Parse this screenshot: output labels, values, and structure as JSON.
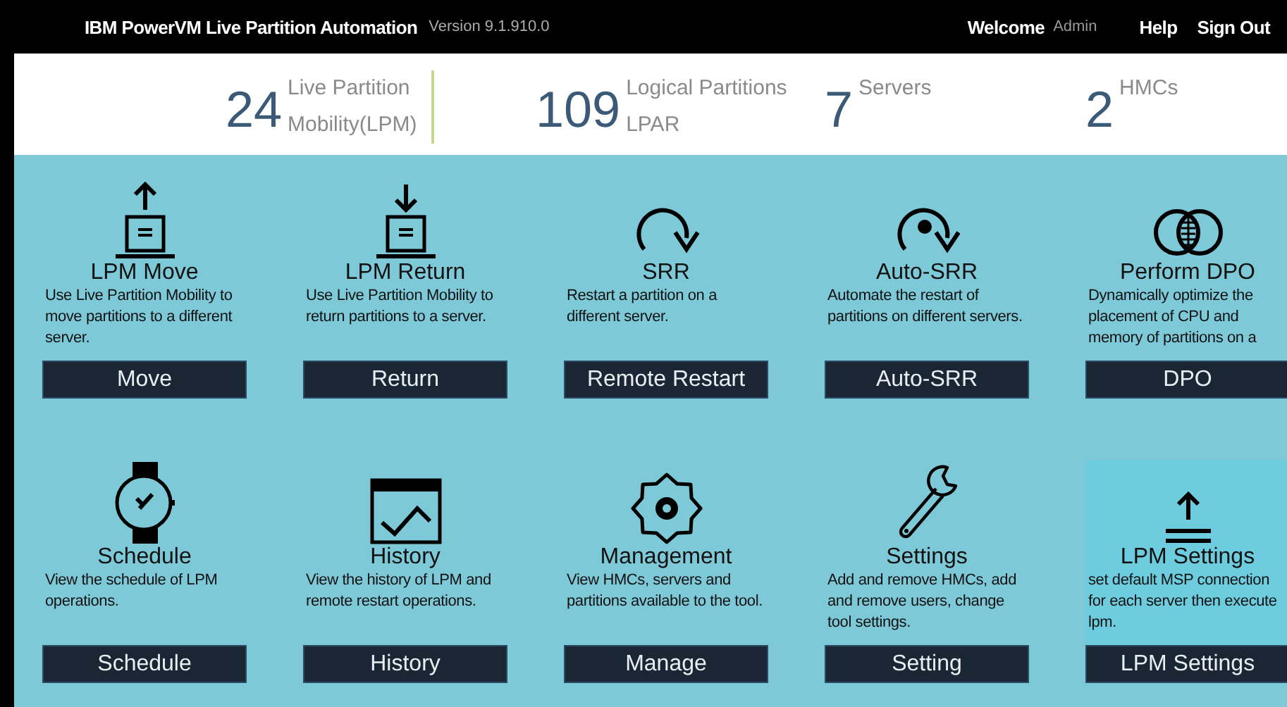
{
  "header": {
    "title": "IBM PowerVM Live Partition Automation",
    "version": "Version 9.1.910.0",
    "welcome": "Welcome",
    "user": "Admin",
    "links": [
      "Help",
      "Sign Out"
    ]
  },
  "stats": [
    {
      "value": "24",
      "lines": [
        "Live Partition",
        "Mobility(LPM)"
      ]
    },
    {
      "value": "109",
      "lines": [
        "Logical Partitions",
        "LPAR"
      ]
    },
    {
      "value": "7",
      "lines": [
        "Servers"
      ]
    },
    {
      "value": "2",
      "lines": [
        "HMCs"
      ]
    }
  ],
  "cards": [
    {
      "title": "LPM Move",
      "description": "Use Live Partition Mobility to move partitions to a different server.",
      "button": "Move",
      "highlighted": false
    },
    {
      "title": "LPM Return",
      "description": "Use Live Partition Mobility to return partitions to a server.",
      "button": "Return",
      "highlighted": false
    },
    {
      "title": "SRR",
      "description": "Restart a partition on a different server.",
      "button": "Remote Restart",
      "highlighted": false
    },
    {
      "title": "Auto-SRR",
      "description": "Automate the restart of partitions on different servers.",
      "button": "Auto-SRR",
      "highlighted": false
    },
    {
      "title": "Perform DPO",
      "description": "Dynamically optimize the placement of CPU and memory of partitions on a",
      "button": "DPO",
      "highlighted": false
    },
    {
      "title": "Schedule",
      "description": "View the schedule of LPM operations.",
      "button": "Schedule",
      "highlighted": false
    },
    {
      "title": "History",
      "description": "View the history of LPM and remote restart operations.",
      "button": "History",
      "highlighted": false
    },
    {
      "title": "Management",
      "description": "View HMCs, servers and partitions available to the tool.",
      "button": "Manage",
      "highlighted": false
    },
    {
      "title": "Settings",
      "description": "Add and remove HMCs, add and remove users, change tool settings.",
      "button": "Setting",
      "highlighted": false
    },
    {
      "title": "LPM Settings",
      "description": "set default MSP connection for each server then execute lpm.",
      "button": "LPM Settings",
      "highlighted": true
    }
  ]
}
